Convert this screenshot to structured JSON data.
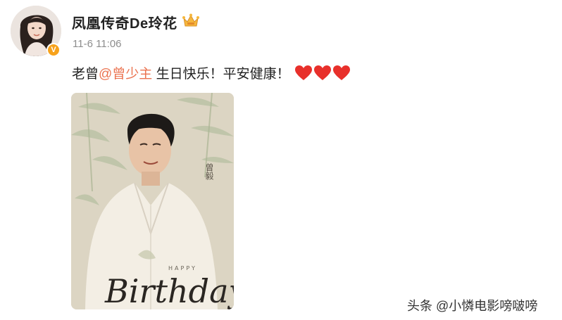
{
  "post": {
    "author": "凤凰传奇De玲花",
    "verified_badge": "V",
    "timestamp": "11-6 11:06",
    "text_prefix": "老曾",
    "mention": "@曾少主",
    "text_suffix": " 生日快乐！平安健康！",
    "emoji": [
      "heart-icon",
      "heart-icon",
      "heart-icon"
    ],
    "image": {
      "name_seal": "曾毅",
      "small_caption": "HAPPY",
      "script_text": "Birthday"
    }
  },
  "watermark": "头条 @小憐电影嗙啵嗙",
  "colors": {
    "mention": "#eb7350",
    "heart": "#e8302b",
    "verified": "#f7a21b",
    "timestamp": "#8d8d8d"
  }
}
